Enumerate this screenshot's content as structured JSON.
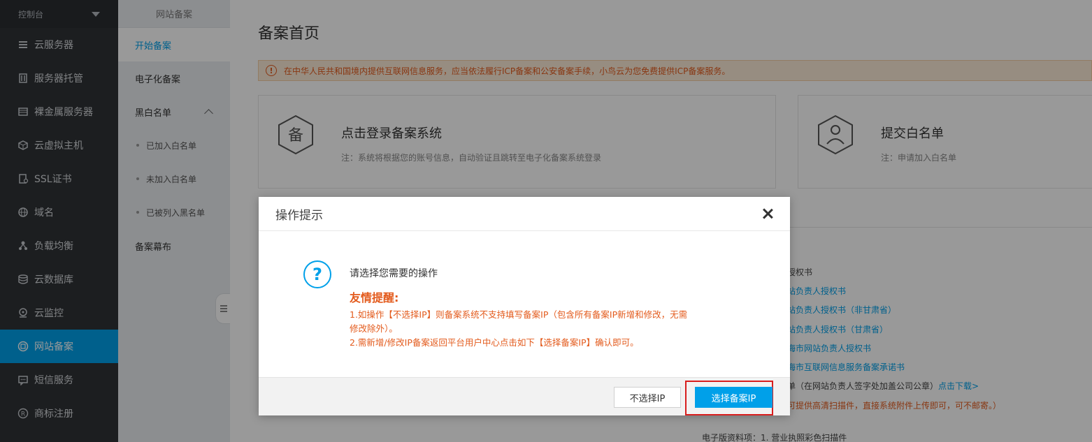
{
  "sidebar": {
    "console_label": "控制台",
    "items": [
      {
        "label": "云服务器",
        "icon": "server-list-icon"
      },
      {
        "label": "服务器托管",
        "icon": "rack-icon"
      },
      {
        "label": "裸金属服务器",
        "icon": "bare-metal-icon"
      },
      {
        "label": "云虚拟主机",
        "icon": "cube-icon"
      },
      {
        "label": "SSL证书",
        "icon": "certificate-icon"
      },
      {
        "label": "域名",
        "icon": "globe-icon"
      },
      {
        "label": "负载均衡",
        "icon": "load-balancer-icon"
      },
      {
        "label": "云数据库",
        "icon": "database-icon"
      },
      {
        "label": "云监控",
        "icon": "monitor-icon"
      },
      {
        "label": "网站备案",
        "icon": "record-icon"
      },
      {
        "label": "短信服务",
        "icon": "sms-icon"
      },
      {
        "label": "商标注册",
        "icon": "trademark-icon"
      }
    ],
    "active_index": 9
  },
  "submenu": {
    "header": "网站备案",
    "start": "开始备案",
    "electronic": "电子化备案",
    "blackwhite": "黑白名单",
    "subs": [
      "已加入白名单",
      "未加入白名单",
      "已被列入黑名单"
    ],
    "curtain": "备案幕布"
  },
  "main": {
    "title": "备案首页",
    "notice": "在中华人民共和国境内提供互联网信息服务，应当依法履行ICP备案和公安备案手续，小鸟云为您免费提供ICP备案服务。",
    "card_login": {
      "icon_text": "备",
      "title": "点击登录备案系统",
      "note": "注：系统将根据您的账号信息，自动验证且跳转至电子化备案系统登录"
    },
    "card_whitelist": {
      "title": "提交白名单",
      "note": "注：申请加入白名单"
    },
    "lines": [
      {
        "text": "授权书",
        "kind": "dark"
      },
      {
        "text": "站负责人授权书",
        "kind": "blue"
      },
      {
        "text": "站负责人授权书（非甘肃省）",
        "kind": "blue"
      },
      {
        "text": "站负责人授权书（甘肃省）",
        "kind": "blue"
      },
      {
        "text": "海市网站负责人授权书",
        "kind": "blue"
      },
      {
        "text": "海市互联网信息服务备案承诺书",
        "kind": "blue"
      }
    ],
    "line_download_prefix": "单（在网站负责人签字处加盖公司公章）",
    "line_download_link": "点击下载>",
    "line_orange": "可提供高清扫描件，直接系统附件上传即可，可不邮寄。）",
    "line_bottom": "电子版资料项：1. 营业执照彩色扫描件"
  },
  "modal": {
    "title": "操作提示",
    "prompt": "请选择您需要的操作",
    "tip_title": "友情提醒:",
    "tip_lines": [
      "1.如操作【不选择IP】则备案系统不支持填写备案IP（包含所有备案IP新增和修改，无需",
      "修改除外）。",
      "2.需新增/修改IP备案返回平台用户中心点击如下【选择备案IP】确认即可。"
    ],
    "btn_no": "不选择IP",
    "btn_yes": "选择备案IP"
  },
  "colors": {
    "accent": "#00a0e9",
    "warning": "#e35b1d",
    "highlight": "#d81e1e",
    "sidebar": "#2f3236"
  }
}
